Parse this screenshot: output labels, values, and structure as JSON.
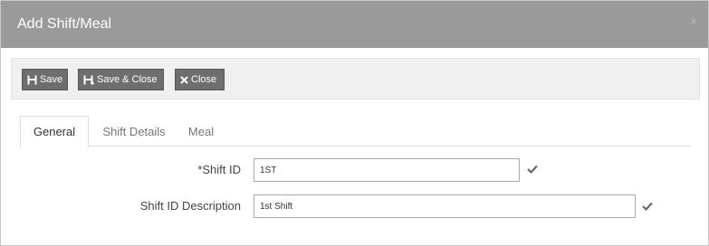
{
  "dialog": {
    "title": "Add Shift/Meal",
    "close_glyph": "×"
  },
  "toolbar": {
    "save_label": "Save",
    "save_close_label": "Save & Close",
    "close_label": "Close",
    "icons": [
      "save-icon",
      "save-close-icon",
      "close-x-icon"
    ]
  },
  "tabs": [
    {
      "label": "General",
      "active": true
    },
    {
      "label": "Shift Details",
      "active": false
    },
    {
      "label": "Meal",
      "active": false
    }
  ],
  "form": {
    "shift_id": {
      "required_mark": "*",
      "label": "Shift ID",
      "value": "1ST",
      "valid": true
    },
    "shift_desc": {
      "label": "Shift ID Description",
      "value": "1st Shift",
      "valid": true
    }
  },
  "colors": {
    "header_bg": "#9a9a9a",
    "button_bg": "#6e6e6e",
    "toolbar_bg": "#f0f0f0"
  }
}
